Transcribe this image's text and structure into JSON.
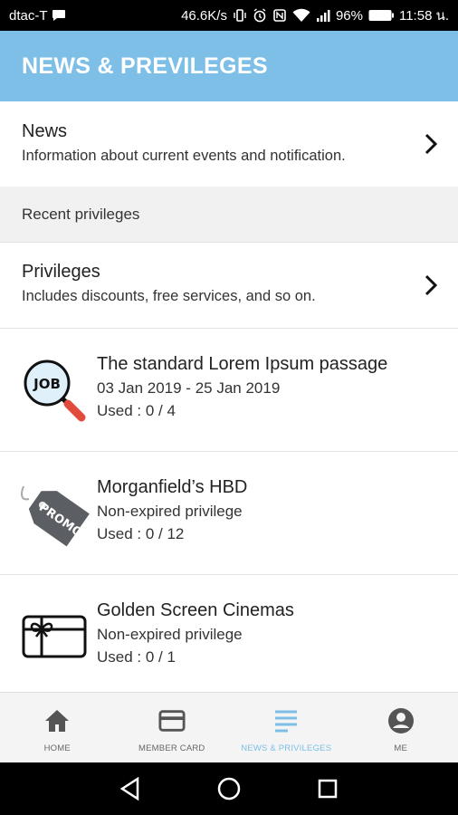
{
  "status_bar": {
    "carrier": "dtac-T",
    "speed": "46.6K/s",
    "battery": "96%",
    "time": "11:58 น."
  },
  "app_bar": {
    "title": "NEWS & PREVILEGES"
  },
  "news": {
    "title": "News",
    "subtitle": "Information about current events and notification."
  },
  "section_header": "Recent privileges",
  "privileges": {
    "title": "Privileges",
    "subtitle": "Includes discounts, free services, and so on."
  },
  "items": [
    {
      "icon": "job-magnifier-icon",
      "title": "The standard Lorem Ipsum passage",
      "line1": "03 Jan 2019 - 25 Jan 2019",
      "line2": "Used : 0 / 4"
    },
    {
      "icon": "promo-tag-icon",
      "title": "Morganfield’s HBD",
      "line1": "Non-expired privilege",
      "line2": "Used : 0 / 12"
    },
    {
      "icon": "gift-card-icon",
      "title": "Golden Screen Cinemas",
      "line1": "Non-expired privilege",
      "line2": "Used : 0 / 1"
    }
  ],
  "promo_tag_text": "PROMO",
  "job_icon_text": "JOB",
  "bottom_nav": {
    "tabs": [
      {
        "label": "HOME",
        "icon": "home-icon",
        "active": false
      },
      {
        "label": "MEMBER CARD",
        "icon": "card-icon",
        "active": false
      },
      {
        "label": "NEWS & PRIVILEGES",
        "icon": "list-icon",
        "active": true
      },
      {
        "label": "ME",
        "icon": "account-icon",
        "active": false
      }
    ]
  },
  "colors": {
    "accent": "#7dbfe6",
    "status_bar": "#000000",
    "divider": "#e3e3e3"
  }
}
